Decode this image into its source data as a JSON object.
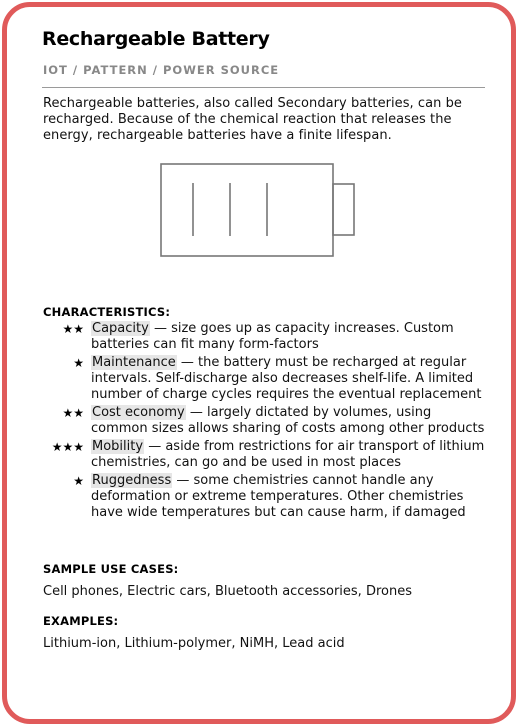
{
  "card": {
    "title": "Rechargeable Battery",
    "breadcrumb": "IOT / PATTERN / POWER SOURCE",
    "intro": "Rechargeable batteries, also called Secondary batteries, can be recharged. Because of the chemical reaction that releases the energy, rechargeable batteries have a finite lifespan.",
    "border_color": "#e05a5a"
  },
  "characteristics": {
    "heading": "CHARACTERISTICS:",
    "items": [
      {
        "stars": "★★",
        "rating": 2,
        "name": "Capacity",
        "description": " — size goes up as capacity increases. Custom batteries can fit many form-factors"
      },
      {
        "stars": "★",
        "rating": 1,
        "name": "Maintenance",
        "description": " — the battery must be recharged at regular intervals. Self-discharge also decreases shelf-life. A limited number of charge cycles requires the eventual replacement"
      },
      {
        "stars": "★★",
        "rating": 2,
        "name": "Cost economy",
        "description": " — largely dictated by volumes, using common sizes allows sharing of costs among other products"
      },
      {
        "stars": "★★★",
        "rating": 3,
        "name": "Mobility",
        "description": " — aside from restrictions for air transport of lithium chemistries, can go and be used in most places"
      },
      {
        "stars": "★",
        "rating": 1,
        "name": "Ruggedness",
        "description": " —  some chemistries cannot handle any deformation or extreme temperatures. Other chemistries have wide temperatures but can cause harm, if damaged"
      }
    ]
  },
  "use_cases": {
    "heading": "SAMPLE USE CASES:",
    "text": "Cell phones, Electric cars, Bluetooth accessories, Drones"
  },
  "examples": {
    "heading": "EXAMPLES:",
    "text": "Lithium-ion, Lithium-polymer, NiMH, Lead acid"
  },
  "icons": {
    "battery": "battery-icon",
    "star": "star-icon"
  }
}
